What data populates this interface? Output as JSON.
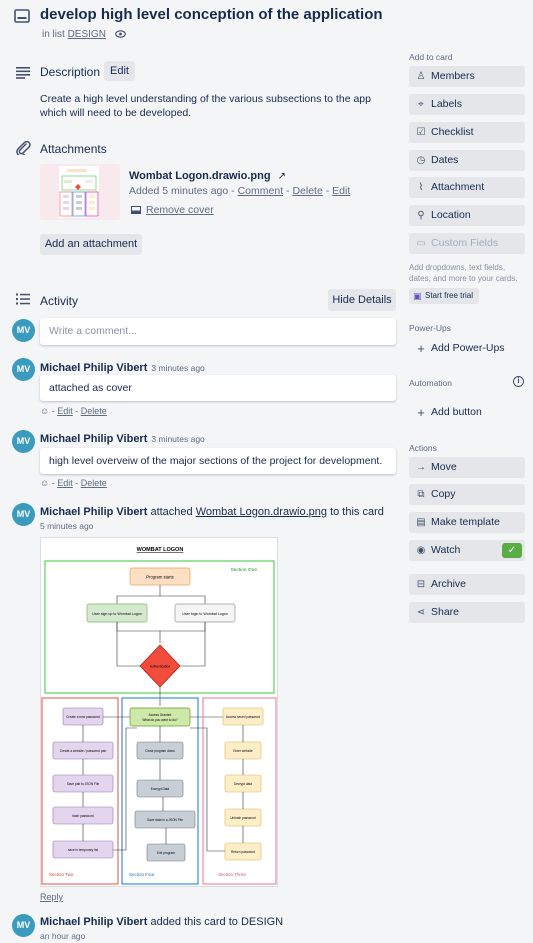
{
  "card": {
    "title": "develop high level conception of the application",
    "in_list_prefix": "in list",
    "list_name": "DESIGN"
  },
  "description": {
    "heading": "Description",
    "edit_label": "Edit",
    "text": "Create a high level understanding of the various subsections to the app which will need to be developed."
  },
  "attachments": {
    "heading": "Attachments",
    "file_name": "Wombat Logon.drawio.png",
    "added": "Added 5 minutes ago",
    "comment_label": "Comment",
    "delete_label": "Delete",
    "edit_label": "Edit",
    "remove_cover_label": "Remove cover",
    "add_label": "Add an attachment"
  },
  "activity": {
    "heading": "Activity",
    "hide_details_label": "Hide Details",
    "comment_placeholder": "Write a comment...",
    "avatar_initials": "MV",
    "items": [
      {
        "author": "Michael Philip Vibert",
        "time": "3 minutes ago",
        "text": "attached as cover",
        "edit": "Edit",
        "delete": "Delete"
      },
      {
        "author": "Michael Philip Vibert",
        "time": "3 minutes ago",
        "text": "high level overveiw of the major sections of the project for development.",
        "edit": "Edit",
        "delete": "Delete"
      }
    ],
    "attach_event": {
      "author": "Michael Philip Vibert",
      "verb": "attached",
      "link": "Wombat Logon.drawio.png",
      "suffix": "to this card",
      "time": "5 minutes ago",
      "reply_label": "Reply"
    },
    "add_event": {
      "author": "Michael Philip Vibert",
      "text": "added this card to DESIGN",
      "time": "an hour ago"
    }
  },
  "diagram": {
    "title": "WOMBAT LOGON",
    "section_one": "Section One",
    "section_two": "Section Two",
    "section_three": "Section Three",
    "section_four": "Section Four",
    "program_starts": "Program starts",
    "sign_up": "User sign up to Wombat Logon",
    "log_in": "User login to Wombat Logon",
    "authentication": "Authentication",
    "access_granted_1": "Access Granted",
    "access_granted_2": "What do you want to do?",
    "create_password": "Create a new password",
    "website_pair": "Create a website / password pair",
    "save_pair": "Save pair to JSON File",
    "hash_password": "hash password",
    "save_temp": "save in temporary list",
    "close_program": "Close program down",
    "encrypt": "Encrypt Data",
    "save_json": "Save data in a JSON File",
    "exit": "Exit program",
    "access_saved": "Access saved password",
    "enter_website": "Enter website",
    "decrypt": "Decrypt data",
    "unhash": "Unhash password",
    "return_pw": "Return password"
  },
  "sidebar": {
    "add_to_card": "Add to card",
    "members": "Members",
    "labels": "Labels",
    "checklist": "Checklist",
    "dates": "Dates",
    "attachment": "Attachment",
    "location": "Location",
    "custom_fields": "Custom Fields",
    "note": "Add dropdowns, text fields, dates, and more to your cards.",
    "start_trial": "Start free trial",
    "power_ups": "Power-Ups",
    "add_power_ups": "Add Power-Ups",
    "automation": "Automation",
    "add_button": "Add button",
    "actions": "Actions",
    "move": "Move",
    "copy": "Copy",
    "make_template": "Make template",
    "watch": "Watch",
    "archive": "Archive",
    "share": "Share"
  },
  "colors": {
    "avatar": "#3a9bbf",
    "watch_check": "#5aac44",
    "section_one": "#5ad35a",
    "section_two": "#e86a6a",
    "section_three": "#f08aa6",
    "section_four": "#3a8ee6"
  }
}
